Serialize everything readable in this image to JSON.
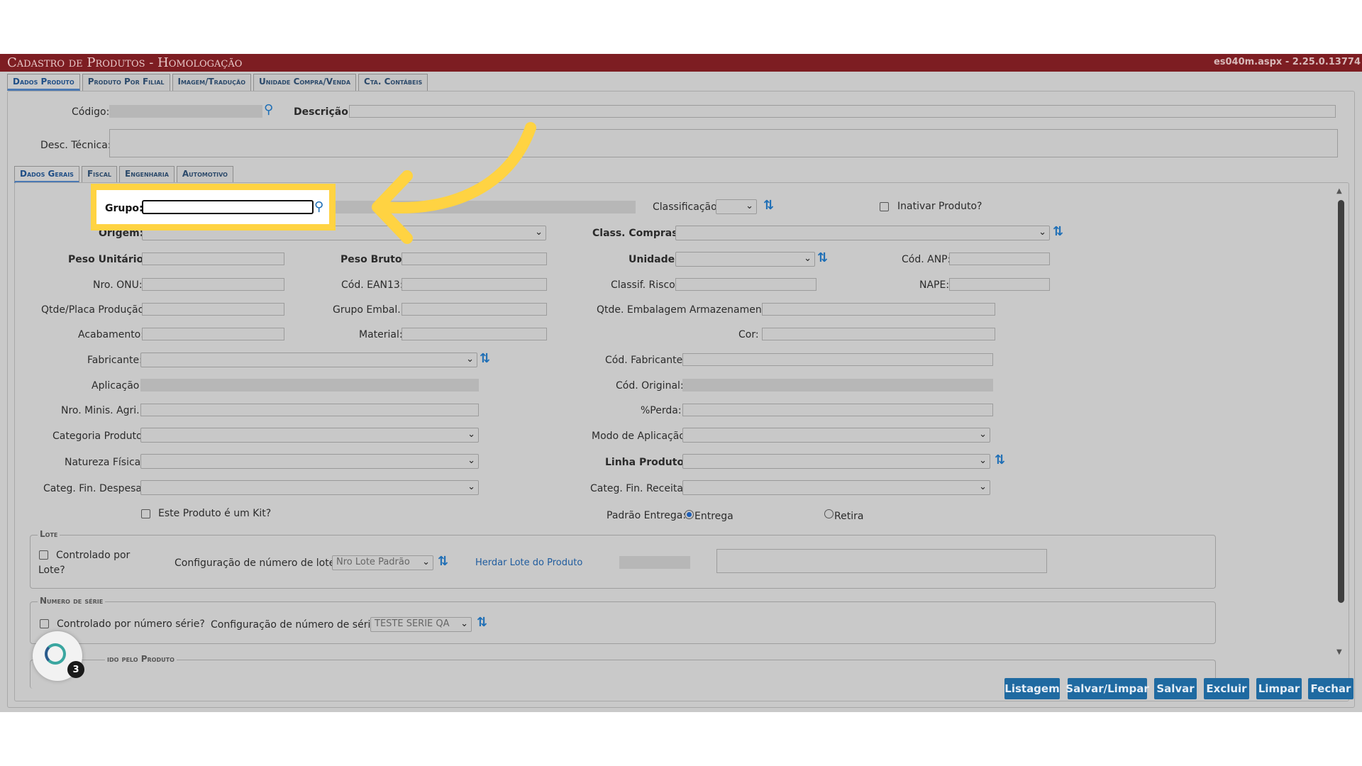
{
  "window": {
    "title": "Cadastro de Produtos  - Homologação",
    "version": "es040m.aspx - 2.25.0.13774"
  },
  "main_tabs": [
    "Dados Produto",
    "Produto Por Filial",
    "Imagem/Tradução",
    "Unidade Compra/Venda",
    "Cta. Contábeis"
  ],
  "header_fields": {
    "codigo_label": "Código:",
    "descricao_label": "Descrição:",
    "desc_tecnica_label": "Desc. Técnica:"
  },
  "sub_tabs": [
    "Dados Gerais",
    "Fiscal",
    "Engenharia",
    "Automotivo"
  ],
  "fields": {
    "grupo": "Grupo:",
    "classificacao": "Classificação:",
    "inativar": "Inativar Produto?",
    "origem": "Origem:",
    "class_compras": "Class. Compras:",
    "peso_unitario": "Peso Unitário:",
    "peso_bruto": "Peso Bruto:",
    "unidade": "Unidade:",
    "cod_anp": "Cód. ANP:",
    "nro_onu": "Nro. ONU:",
    "cod_ean13": "Cód. EAN13:",
    "classif_risco": "Classif. Risco:",
    "nape": "NAPE:",
    "qtde_placa": "Qtde/Placa Produção:",
    "grupo_embal": "Grupo Embal.:",
    "qtde_embalagem": "Qtde. Embalagem Armazenamento:",
    "acabamento": "Acabamento:",
    "material": "Material:",
    "cor": "Cor:",
    "fabricante": "Fabricante:",
    "cod_fabricante": "Cód. Fabricante:",
    "aplicacao": "Aplicação:",
    "cod_original": "Cód. Original:",
    "nro_minis_agri": "Nro. Minis. Agri.:",
    "perda": "%Perda:",
    "categoria_produto": "Categoria Produto:",
    "modo_aplicacao": "Modo de Aplicação:",
    "natureza_fisica": "Natureza Física:",
    "linha_produto": "Linha Produto:",
    "categ_fin_despesa": "Categ. Fin. Despesa:",
    "categ_fin_receita": "Categ. Fin. Receita:",
    "kit": "Este Produto é um Kit?",
    "padrao_entrega": "Padrão Entrega:",
    "entrega": "Entrega",
    "retira": "Retira"
  },
  "lote": {
    "legend": "Lote",
    "controlado_line1": "Controlado por",
    "controlado_line2": "Lote?",
    "config_label": "Configuração de número de lote:",
    "config_value": "Nro Lote Padrão",
    "herdar_link": "Herdar Lote do Produto"
  },
  "serie": {
    "legend": "Numero de série",
    "controlado": "Controlado por número série?",
    "config_label": "Configuração de número de série:",
    "config_value": "TESTE SERIE QA"
  },
  "partial_section_legend": "ido pelo Produto",
  "buttons": [
    "Listagem",
    "Salvar/Limpar",
    "Salvar",
    "Excluir",
    "Limpar",
    "Fechar"
  ],
  "helper_badge": "3",
  "colors": {
    "titlebar": "#7d1d22",
    "button": "#1f6aa1",
    "highlight": "#ffd342",
    "overlay_bg": "#c9c9c9"
  }
}
